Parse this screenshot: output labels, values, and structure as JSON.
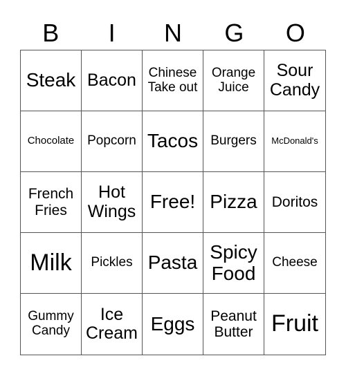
{
  "header": [
    "B",
    "I",
    "N",
    "G",
    "O"
  ],
  "cells": [
    {
      "text": "Steak",
      "size": "s-l"
    },
    {
      "text": "Bacon",
      "size": "s-m"
    },
    {
      "text": "Chinese Take out",
      "size": "s-s"
    },
    {
      "text": "Orange Juice",
      "size": "s-s"
    },
    {
      "text": "Sour Candy",
      "size": "s-m"
    },
    {
      "text": "Chocolate",
      "size": "s-xs"
    },
    {
      "text": "Popcorn",
      "size": "s-s"
    },
    {
      "text": "Tacos",
      "size": "s-l"
    },
    {
      "text": "Burgers",
      "size": "s-s"
    },
    {
      "text": "McDonald's",
      "size": "s-xxs"
    },
    {
      "text": "French Fries",
      "size": "s-ms"
    },
    {
      "text": "Hot Wings",
      "size": "s-m"
    },
    {
      "text": "Free!",
      "size": "s-l"
    },
    {
      "text": "Pizza",
      "size": "s-l"
    },
    {
      "text": "Doritos",
      "size": "s-ms"
    },
    {
      "text": "Milk",
      "size": "s-xl"
    },
    {
      "text": "Pickles",
      "size": "s-s"
    },
    {
      "text": "Pasta",
      "size": "s-l"
    },
    {
      "text": "Spicy Food",
      "size": "s-l"
    },
    {
      "text": "Cheese",
      "size": "s-s"
    },
    {
      "text": "Gummy Candy",
      "size": "s-s"
    },
    {
      "text": "Ice Cream",
      "size": "s-m"
    },
    {
      "text": "Eggs",
      "size": "s-l"
    },
    {
      "text": "Peanut Butter",
      "size": "s-ms"
    },
    {
      "text": "Fruit",
      "size": "s-xl"
    }
  ]
}
